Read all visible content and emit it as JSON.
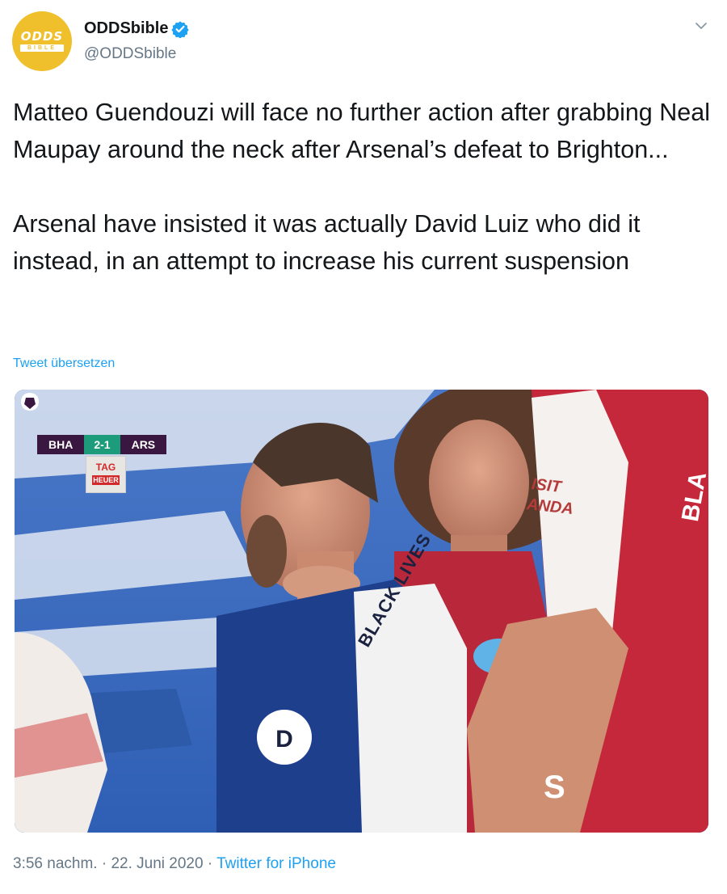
{
  "header": {
    "avatar_logo_text": "ODDS",
    "avatar_logo_sub": "BIBLE",
    "display_name": "ODDSbible",
    "handle": "@ODDSbible"
  },
  "tweet": {
    "paragraph1": "Matteo Guendouzi will face no further action after grabbing Neal Maupay around the neck after Arsenal’s defeat to Brighton...",
    "paragraph2": "Arsenal have insisted it was actually David Luiz who did it instead, in an attempt to increase his current suspension",
    "translate_label": "Tweet übersetzen"
  },
  "media": {
    "scorebug": {
      "home": "BHA",
      "score": "2-1",
      "away": "ARS"
    },
    "sponsor_badge_top": "TAG",
    "sponsor_badge_sub": "HEUER",
    "shirt_sponsor_line1": "ISIT",
    "shirt_sponsor_line2": "ANDA",
    "sleeve_text": "BLA",
    "shirt_slogan": "BLACK LIVES",
    "shirt_number_fragment": "S"
  },
  "footer": {
    "time": "3:56 nachm.",
    "separator": "·",
    "date": "22. Juni 2020",
    "source": "Twitter for iPhone"
  },
  "colors": {
    "verified_blue": "#1da1f2",
    "link_blue": "#1da1f2",
    "muted_gray": "#657786",
    "avatar_yellow": "#efbf2c"
  },
  "icons": {
    "verified": "verified-badge-icon",
    "caret": "chevron-down-icon"
  }
}
